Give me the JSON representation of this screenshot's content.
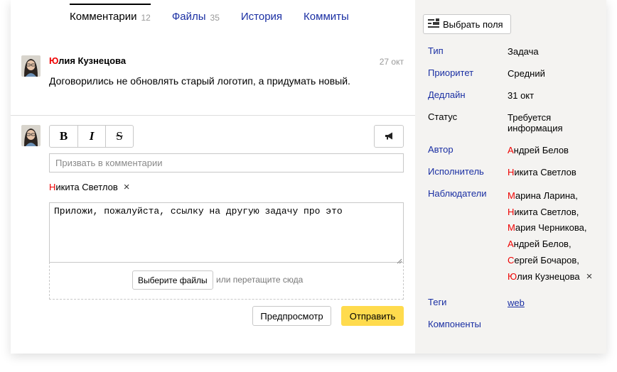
{
  "tabs": [
    {
      "label": "Комментарии",
      "count": "12",
      "active": true
    },
    {
      "label": "Файлы",
      "count": "35",
      "active": false
    },
    {
      "label": "История",
      "count": "",
      "active": false
    },
    {
      "label": "Коммиты",
      "count": "",
      "active": false
    }
  ],
  "comment": {
    "author_first": "Ю",
    "author_rest": "лия Кузнецова",
    "date": "27 окт",
    "text": "Договорились не обновлять старый логотип, а придумать новый."
  },
  "editor": {
    "bold_label": "B",
    "italic_label": "I",
    "strike_label": "S",
    "summon_placeholder": "Призвать в комментарии",
    "summoned_first": "Н",
    "summoned_rest": "икита Светлов",
    "remove_glyph": "×",
    "text": "Приложи, пожалуйста, ссылку на другую задачу про это",
    "choose_files_label": "Выберите файлы",
    "drop_hint": "или перетащите сюда",
    "preview_label": "Предпросмотр",
    "send_label": "Отправить"
  },
  "sidebar": {
    "choose_fields_label": "Выбрать поля",
    "fields": {
      "type_label": "Тип",
      "type_value": "Задача",
      "priority_label": "Приоритет",
      "priority_value": "Средний",
      "deadline_label": "Дедлайн",
      "deadline_value": "31 окт",
      "status_label": "Статус",
      "status_value": "Требуется информация",
      "author_label": "Автор",
      "author_first": "А",
      "author_rest": "ндрей Белов",
      "assignee_label": "Исполнитель",
      "assignee_first": "Н",
      "assignee_rest": "икита Светлов",
      "watchers_label": "Наблюдатели",
      "tags_label": "Теги",
      "tag": "web",
      "components_label": "Компоненты"
    },
    "watchers": [
      {
        "first": "М",
        "rest": "арина Ларина,"
      },
      {
        "first": "Н",
        "rest": "икита Светлов,"
      },
      {
        "first": "М",
        "rest": "ария Черникова,"
      },
      {
        "first": "А",
        "rest": "ндрей Белов,"
      },
      {
        "first": "С",
        "rest": "ергей Бочаров,"
      },
      {
        "first": "Ю",
        "rest": "лия Кузнецова"
      }
    ]
  },
  "colors": {
    "accent_link": "#1a2fa3",
    "send_button": "#ffdb4d",
    "name_initial": "#ee0000",
    "sidebar_bg": "#f4f3f1"
  },
  "icons": [
    "avatar",
    "megaphone-icon",
    "fields-icon",
    "close-icon",
    "resize-grip-icon"
  ]
}
